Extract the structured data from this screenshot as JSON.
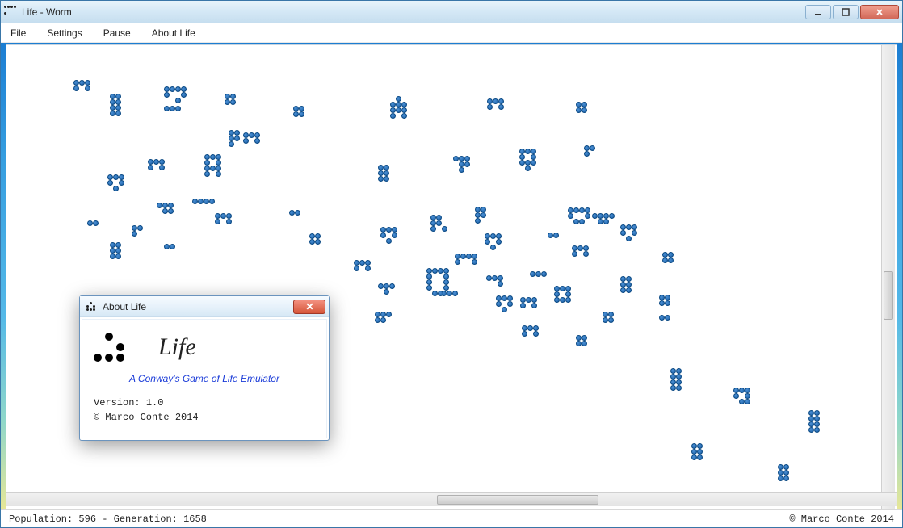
{
  "window": {
    "title": "Life - Worm"
  },
  "menu": {
    "file": "File",
    "settings": "Settings",
    "pause": "Pause",
    "about": "About Life"
  },
  "status": {
    "left_label": "Population:",
    "population": "596",
    "sep": " - ",
    "gen_label": "Generation:",
    "generation": "1658",
    "right": "© Marco Conte 2014"
  },
  "about": {
    "title": "About Life",
    "logo": "Life",
    "link": "A Conway's Game of Life Emulator",
    "version_label": "Version:",
    "version": "1.0",
    "copyright": "© Marco Conte 2014"
  },
  "cells": [
    [
      83,
      43
    ],
    [
      90,
      43
    ],
    [
      97,
      43
    ],
    [
      83,
      50
    ],
    [
      97,
      50
    ],
    [
      128,
      60
    ],
    [
      135,
      60
    ],
    [
      128,
      67
    ],
    [
      135,
      67
    ],
    [
      128,
      74
    ],
    [
      135,
      74
    ],
    [
      128,
      81
    ],
    [
      135,
      81
    ],
    [
      195,
      51
    ],
    [
      202,
      51
    ],
    [
      209,
      51
    ],
    [
      216,
      51
    ],
    [
      195,
      58
    ],
    [
      216,
      58
    ],
    [
      209,
      65
    ],
    [
      195,
      75
    ],
    [
      202,
      75
    ],
    [
      209,
      75
    ],
    [
      270,
      60
    ],
    [
      277,
      60
    ],
    [
      270,
      67
    ],
    [
      277,
      67
    ],
    [
      355,
      75
    ],
    [
      362,
      75
    ],
    [
      355,
      82
    ],
    [
      362,
      82
    ],
    [
      475,
      70
    ],
    [
      482,
      70
    ],
    [
      489,
      70
    ],
    [
      482,
      63
    ],
    [
      475,
      77
    ],
    [
      482,
      77
    ],
    [
      489,
      77
    ],
    [
      475,
      84
    ],
    [
      489,
      84
    ],
    [
      595,
      66
    ],
    [
      602,
      66
    ],
    [
      609,
      66
    ],
    [
      595,
      73
    ],
    [
      609,
      73
    ],
    [
      705,
      70
    ],
    [
      712,
      70
    ],
    [
      705,
      77
    ],
    [
      712,
      77
    ],
    [
      125,
      160
    ],
    [
      132,
      160
    ],
    [
      139,
      160
    ],
    [
      125,
      167
    ],
    [
      139,
      167
    ],
    [
      132,
      174
    ],
    [
      175,
      141
    ],
    [
      182,
      141
    ],
    [
      189,
      141
    ],
    [
      175,
      148
    ],
    [
      189,
      148
    ],
    [
      245,
      135
    ],
    [
      252,
      135
    ],
    [
      259,
      135
    ],
    [
      245,
      142
    ],
    [
      259,
      142
    ],
    [
      245,
      149
    ],
    [
      252,
      149
    ],
    [
      259,
      149
    ],
    [
      245,
      156
    ],
    [
      259,
      156
    ],
    [
      230,
      190
    ],
    [
      237,
      190
    ],
    [
      244,
      190
    ],
    [
      251,
      190
    ],
    [
      275,
      105
    ],
    [
      282,
      105
    ],
    [
      275,
      112
    ],
    [
      282,
      112
    ],
    [
      275,
      119
    ],
    [
      293,
      108
    ],
    [
      300,
      108
    ],
    [
      307,
      108
    ],
    [
      293,
      115
    ],
    [
      307,
      115
    ],
    [
      350,
      204
    ],
    [
      357,
      204
    ],
    [
      100,
      217
    ],
    [
      107,
      217
    ],
    [
      186,
      195
    ],
    [
      193,
      195
    ],
    [
      200,
      195
    ],
    [
      193,
      202
    ],
    [
      200,
      202
    ],
    [
      258,
      208
    ],
    [
      265,
      208
    ],
    [
      272,
      208
    ],
    [
      258,
      215
    ],
    [
      272,
      215
    ],
    [
      460,
      148
    ],
    [
      467,
      148
    ],
    [
      460,
      155
    ],
    [
      467,
      155
    ],
    [
      460,
      162
    ],
    [
      467,
      162
    ],
    [
      553,
      137
    ],
    [
      560,
      137
    ],
    [
      567,
      137
    ],
    [
      560,
      144
    ],
    [
      567,
      144
    ],
    [
      560,
      151
    ],
    [
      635,
      128
    ],
    [
      642,
      128
    ],
    [
      649,
      128
    ],
    [
      635,
      135
    ],
    [
      649,
      135
    ],
    [
      635,
      142
    ],
    [
      642,
      142
    ],
    [
      649,
      142
    ],
    [
      642,
      149
    ],
    [
      715,
      124
    ],
    [
      722,
      124
    ],
    [
      715,
      131
    ],
    [
      128,
      244
    ],
    [
      135,
      244
    ],
    [
      128,
      251
    ],
    [
      135,
      251
    ],
    [
      128,
      258
    ],
    [
      135,
      258
    ],
    [
      155,
      223
    ],
    [
      162,
      223
    ],
    [
      155,
      230
    ],
    [
      195,
      246
    ],
    [
      202,
      246
    ],
    [
      375,
      233
    ],
    [
      382,
      233
    ],
    [
      375,
      240
    ],
    [
      382,
      240
    ],
    [
      430,
      266
    ],
    [
      437,
      266
    ],
    [
      444,
      266
    ],
    [
      430,
      273
    ],
    [
      444,
      273
    ],
    [
      463,
      225
    ],
    [
      470,
      225
    ],
    [
      477,
      225
    ],
    [
      463,
      232
    ],
    [
      477,
      232
    ],
    [
      470,
      239
    ],
    [
      525,
      210
    ],
    [
      532,
      210
    ],
    [
      525,
      217
    ],
    [
      532,
      217
    ],
    [
      525,
      224
    ],
    [
      539,
      224
    ],
    [
      580,
      200
    ],
    [
      587,
      200
    ],
    [
      580,
      207
    ],
    [
      587,
      207
    ],
    [
      580,
      214
    ],
    [
      695,
      201
    ],
    [
      702,
      201
    ],
    [
      709,
      201
    ],
    [
      716,
      201
    ],
    [
      695,
      208
    ],
    [
      716,
      208
    ],
    [
      702,
      215
    ],
    [
      709,
      215
    ],
    [
      725,
      208
    ],
    [
      732,
      208
    ],
    [
      739,
      208
    ],
    [
      746,
      208
    ],
    [
      732,
      215
    ],
    [
      739,
      215
    ],
    [
      538,
      304
    ],
    [
      545,
      304
    ],
    [
      552,
      304
    ],
    [
      460,
      295
    ],
    [
      467,
      295
    ],
    [
      474,
      295
    ],
    [
      467,
      302
    ],
    [
      555,
      258
    ],
    [
      562,
      258
    ],
    [
      569,
      258
    ],
    [
      576,
      258
    ],
    [
      555,
      265
    ],
    [
      576,
      265
    ],
    [
      592,
      233
    ],
    [
      599,
      233
    ],
    [
      606,
      233
    ],
    [
      592,
      240
    ],
    [
      606,
      240
    ],
    [
      599,
      247
    ],
    [
      670,
      232
    ],
    [
      677,
      232
    ],
    [
      700,
      248
    ],
    [
      707,
      248
    ],
    [
      714,
      248
    ],
    [
      700,
      255
    ],
    [
      714,
      255
    ],
    [
      760,
      222
    ],
    [
      767,
      222
    ],
    [
      774,
      222
    ],
    [
      760,
      229
    ],
    [
      774,
      229
    ],
    [
      767,
      236
    ],
    [
      812,
      256
    ],
    [
      819,
      256
    ],
    [
      812,
      263
    ],
    [
      819,
      263
    ],
    [
      520,
      276
    ],
    [
      527,
      276
    ],
    [
      534,
      276
    ],
    [
      541,
      276
    ],
    [
      520,
      283
    ],
    [
      541,
      283
    ],
    [
      520,
      290
    ],
    [
      541,
      290
    ],
    [
      520,
      297
    ],
    [
      541,
      297
    ],
    [
      527,
      304
    ],
    [
      534,
      304
    ],
    [
      594,
      285
    ],
    [
      601,
      285
    ],
    [
      608,
      285
    ],
    [
      608,
      292
    ],
    [
      606,
      310
    ],
    [
      613,
      310
    ],
    [
      620,
      310
    ],
    [
      606,
      317
    ],
    [
      620,
      317
    ],
    [
      613,
      324
    ],
    [
      648,
      280
    ],
    [
      655,
      280
    ],
    [
      662,
      280
    ],
    [
      636,
      312
    ],
    [
      643,
      312
    ],
    [
      650,
      312
    ],
    [
      636,
      319
    ],
    [
      650,
      319
    ],
    [
      678,
      298
    ],
    [
      685,
      298
    ],
    [
      692,
      298
    ],
    [
      678,
      305
    ],
    [
      692,
      305
    ],
    [
      678,
      312
    ],
    [
      685,
      312
    ],
    [
      692,
      312
    ],
    [
      760,
      286
    ],
    [
      767,
      286
    ],
    [
      760,
      293
    ],
    [
      767,
      293
    ],
    [
      760,
      300
    ],
    [
      767,
      300
    ],
    [
      808,
      309
    ],
    [
      815,
      309
    ],
    [
      808,
      316
    ],
    [
      815,
      316
    ],
    [
      808,
      334
    ],
    [
      815,
      334
    ],
    [
      822,
      400
    ],
    [
      829,
      400
    ],
    [
      822,
      407
    ],
    [
      829,
      407
    ],
    [
      822,
      414
    ],
    [
      829,
      414
    ],
    [
      822,
      421
    ],
    [
      829,
      421
    ],
    [
      900,
      424
    ],
    [
      907,
      424
    ],
    [
      914,
      424
    ],
    [
      900,
      431
    ],
    [
      914,
      431
    ],
    [
      907,
      438
    ],
    [
      914,
      438
    ],
    [
      848,
      493
    ],
    [
      855,
      493
    ],
    [
      848,
      500
    ],
    [
      855,
      500
    ],
    [
      848,
      507
    ],
    [
      855,
      507
    ],
    [
      993,
      452
    ],
    [
      1000,
      452
    ],
    [
      993,
      459
    ],
    [
      1000,
      459
    ],
    [
      993,
      466
    ],
    [
      1000,
      466
    ],
    [
      993,
      473
    ],
    [
      1000,
      473
    ],
    [
      955,
      519
    ],
    [
      962,
      519
    ],
    [
      955,
      526
    ],
    [
      962,
      526
    ],
    [
      955,
      533
    ],
    [
      962,
      533
    ],
    [
      456,
      330
    ],
    [
      463,
      330
    ],
    [
      470,
      330
    ],
    [
      456,
      337
    ],
    [
      463,
      337
    ],
    [
      638,
      347
    ],
    [
      645,
      347
    ],
    [
      652,
      347
    ],
    [
      638,
      354
    ],
    [
      652,
      354
    ],
    [
      705,
      359
    ],
    [
      712,
      359
    ],
    [
      705,
      366
    ],
    [
      712,
      366
    ],
    [
      738,
      330
    ],
    [
      745,
      330
    ],
    [
      738,
      337
    ],
    [
      745,
      337
    ]
  ]
}
